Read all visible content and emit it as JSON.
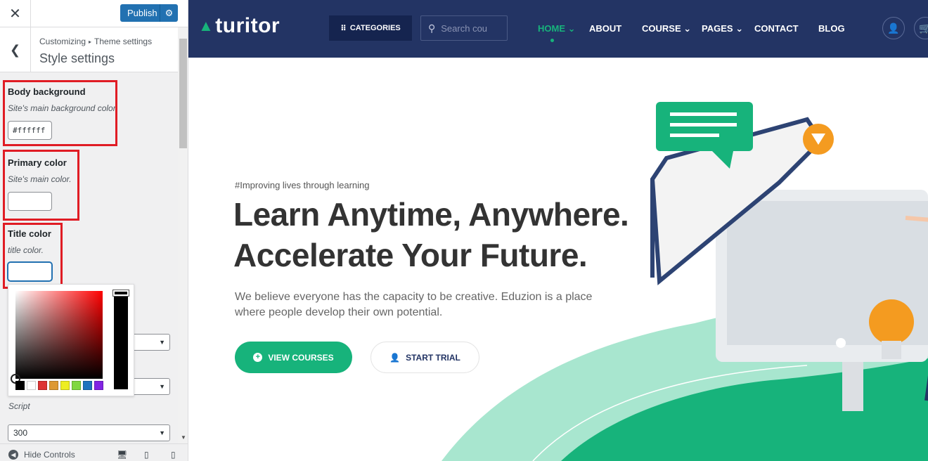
{
  "customizer": {
    "close_icon": "close-icon",
    "publish_label": "Publish",
    "breadcrumb_parent": "Customizing",
    "breadcrumb_section": "Theme settings",
    "section_title": "Style settings",
    "controls": {
      "body_background": {
        "label": "Body background",
        "description": "Site's main background color.",
        "value": "#ffffff"
      },
      "primary_color": {
        "label": "Primary color",
        "description": "Site's main color.",
        "value": ""
      },
      "title_color": {
        "label": "Title color",
        "description": "title color.",
        "value": ""
      }
    },
    "color_picker": {
      "swatches": [
        "#000000",
        "#ffffff",
        "#dd3333",
        "#dd9933",
        "#eeee22",
        "#81d742",
        "#1e73be",
        "#8224e3"
      ]
    },
    "script_label": "Script",
    "font_weight_value": "300",
    "footer": {
      "hide_controls": "Hide Controls"
    },
    "highlight_color": "#e01c24"
  },
  "site": {
    "logo_text": "turitor",
    "categories_label": "CATEGORIES",
    "search_placeholder": "Search cou",
    "nav": {
      "home": "HOME",
      "about": "ABOUT",
      "course": "COURSE",
      "pages": "PAGES",
      "contact": "CONTACT",
      "blog": "BLOG"
    },
    "hero": {
      "tagline": "#Improving lives through learning",
      "headline_1": "Learn Anytime, Anywhere.",
      "headline_2": "Accelerate Your Future.",
      "description": "We believe everyone has the capacity to be creative. Eduzion is a place where people develop their own potential.",
      "primary_button": "VIEW COURSES",
      "secondary_button": "START TRIAL"
    },
    "colors": {
      "header_bg": "#233464",
      "accent": "#17b37b",
      "headline": "#333333"
    }
  }
}
